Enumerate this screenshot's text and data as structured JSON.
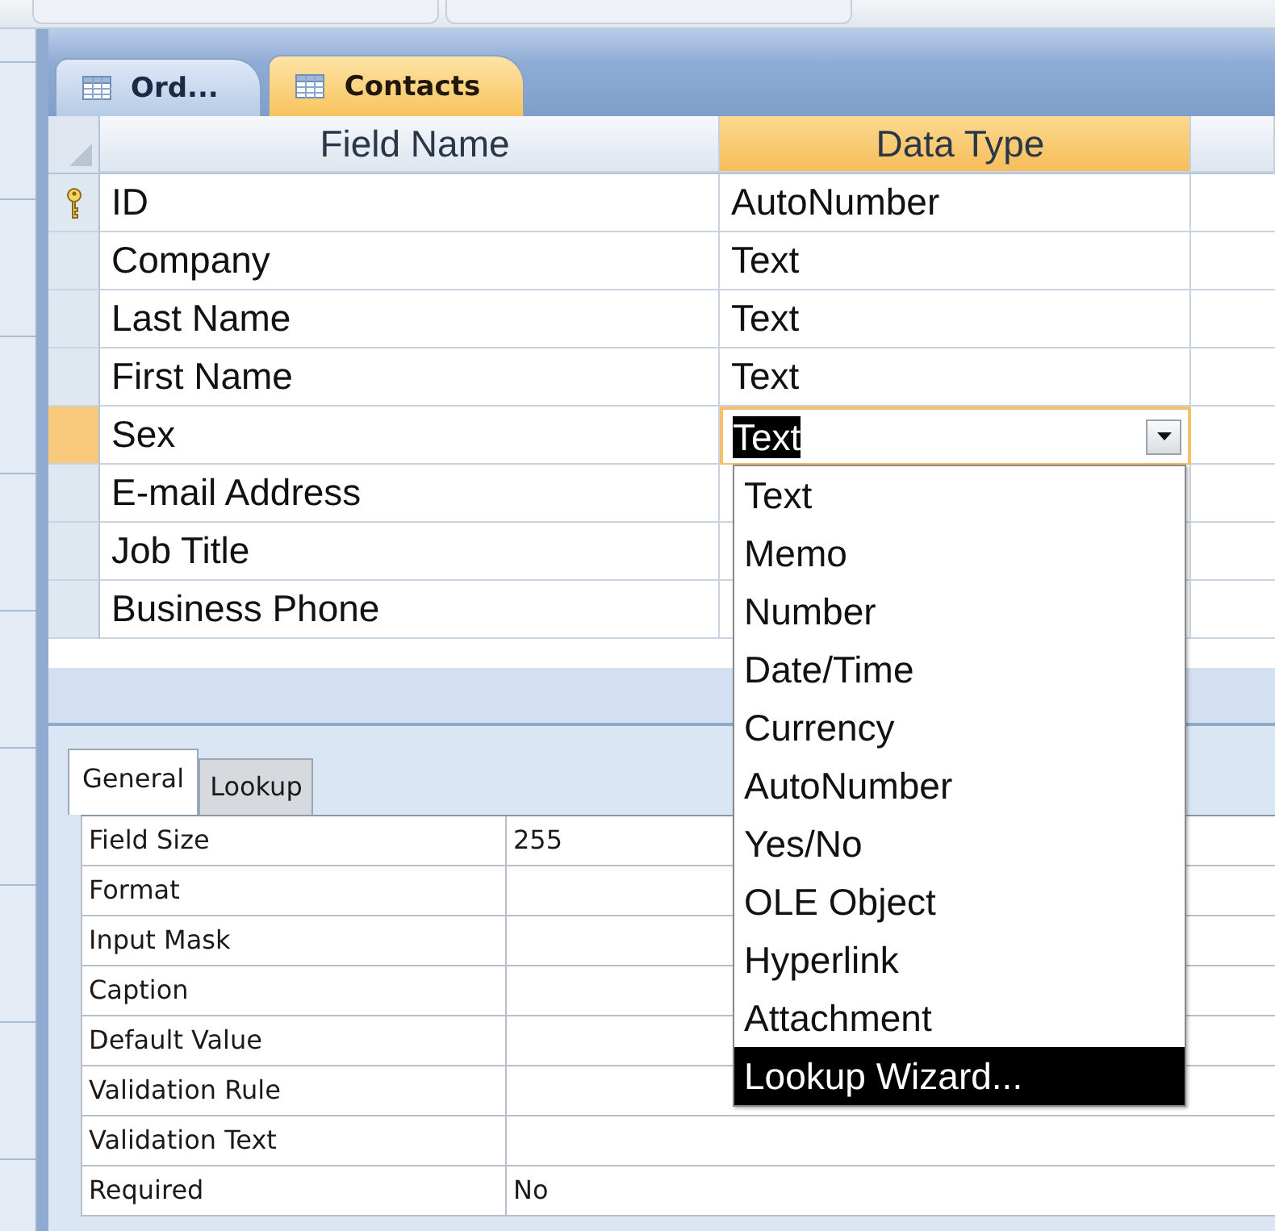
{
  "document_tabs": [
    {
      "label": "Ord...",
      "selected": false
    },
    {
      "label": "Contacts",
      "selected": true
    }
  ],
  "design_grid": {
    "columns": [
      {
        "label": "Field Name",
        "selected": false
      },
      {
        "label": "Data Type",
        "selected": true
      }
    ],
    "rows": [
      {
        "field_name": "ID",
        "data_type": "AutoNumber",
        "primary_key": true,
        "selected": false
      },
      {
        "field_name": "Company",
        "data_type": "Text",
        "primary_key": false,
        "selected": false
      },
      {
        "field_name": "Last Name",
        "data_type": "Text",
        "primary_key": false,
        "selected": false
      },
      {
        "field_name": "First Name",
        "data_type": "Text",
        "primary_key": false,
        "selected": false
      },
      {
        "field_name": "Sex",
        "data_type": "Text",
        "primary_key": false,
        "selected": true
      },
      {
        "field_name": "E-mail Address",
        "primary_key": false,
        "selected": false
      },
      {
        "field_name": "Job Title",
        "primary_key": false,
        "selected": false
      },
      {
        "field_name": "Business Phone",
        "primary_key": false,
        "selected": false
      }
    ]
  },
  "type_dropdown": {
    "options": [
      {
        "label": "Text",
        "selected": false
      },
      {
        "label": "Memo",
        "selected": false
      },
      {
        "label": "Number",
        "selected": false
      },
      {
        "label": "Date/Time",
        "selected": false
      },
      {
        "label": "Currency",
        "selected": false
      },
      {
        "label": "AutoNumber",
        "selected": false
      },
      {
        "label": "Yes/No",
        "selected": false
      },
      {
        "label": "OLE Object",
        "selected": false
      },
      {
        "label": "Hyperlink",
        "selected": false
      },
      {
        "label": "Attachment",
        "selected": false
      },
      {
        "label": "Lookup Wizard...",
        "selected": true
      }
    ]
  },
  "field_properties": {
    "tabs": [
      {
        "label": "General",
        "selected": true
      },
      {
        "label": "Lookup",
        "selected": false
      }
    ],
    "rows": [
      {
        "label": "Field Size",
        "value": "255"
      },
      {
        "label": "Format"
      },
      {
        "label": "Input Mask"
      },
      {
        "label": "Caption"
      },
      {
        "label": "Default Value"
      },
      {
        "label": "Validation Rule"
      },
      {
        "label": "Validation Text"
      },
      {
        "label": "Required",
        "value": "No"
      }
    ]
  }
}
